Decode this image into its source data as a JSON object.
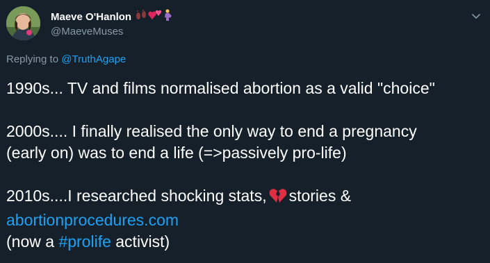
{
  "author": {
    "display_name": "Maeve O'Hanlon",
    "name_emojis": [
      "footprints-emoji",
      "two-hearts-emoji",
      "pregnant-woman-emoji"
    ],
    "handle": "@MaeveMuses"
  },
  "reply": {
    "prefix": "Replying to",
    "handle": "@TruthAgape"
  },
  "tweet": {
    "line1": "1990s... TV and films normalised abortion as a valid \"choice\"",
    "line2a": "2000s.... I finally realised the only way to end a pregnancy",
    "line2b": "(early on) was to end a life (=>passively pro-life)",
    "line3_before": "2010s....I researched shocking stats,",
    "line3_emoji": "broken-heart-emoji",
    "line3_after": "stories &",
    "link": "abortionprocedures.com",
    "line4_before": "(now a",
    "hashtag": "#prolife",
    "line4_after": "activist)"
  },
  "colors": {
    "background": "#15202b",
    "text": "#ffffff",
    "secondary": "#8899a6",
    "accent": "#1da1f2"
  },
  "icons": {
    "more": "chevron-down-icon"
  }
}
